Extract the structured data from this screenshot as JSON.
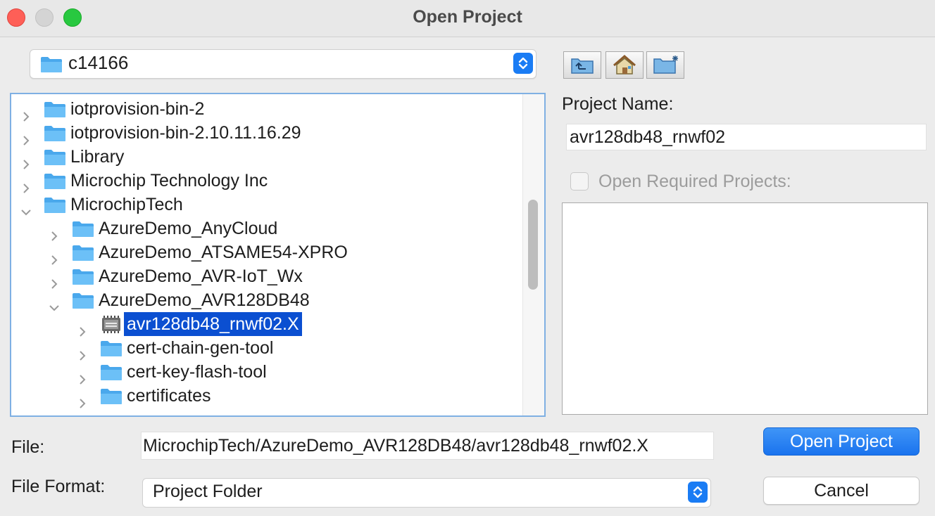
{
  "window": {
    "title": "Open Project"
  },
  "location": {
    "current_folder": "c14166"
  },
  "tree": {
    "items": [
      {
        "label": "iotprovision-bin-2",
        "level": 0,
        "expanded": false,
        "icon": "folder-icon",
        "selected": false
      },
      {
        "label": "iotprovision-bin-2.10.11.16.29",
        "level": 0,
        "expanded": false,
        "icon": "folder-icon",
        "selected": false
      },
      {
        "label": "Library",
        "level": 0,
        "expanded": false,
        "icon": "folder-icon",
        "selected": false
      },
      {
        "label": "Microchip Technology Inc",
        "level": 0,
        "expanded": false,
        "icon": "folder-icon",
        "selected": false
      },
      {
        "label": "MicrochipTech",
        "level": 0,
        "expanded": true,
        "icon": "folder-icon",
        "selected": false
      },
      {
        "label": "AzureDemo_AnyCloud",
        "level": 1,
        "expanded": false,
        "icon": "folder-icon",
        "selected": false
      },
      {
        "label": "AzureDemo_ATSAME54-XPRO",
        "level": 1,
        "expanded": false,
        "icon": "folder-icon",
        "selected": false
      },
      {
        "label": "AzureDemo_AVR-IoT_Wx",
        "level": 1,
        "expanded": false,
        "icon": "folder-icon",
        "selected": false
      },
      {
        "label": "AzureDemo_AVR128DB48",
        "level": 1,
        "expanded": true,
        "icon": "folder-icon",
        "selected": false
      },
      {
        "label": "avr128db48_rnwf02.X",
        "level": 2,
        "expanded": false,
        "icon": "chip-project-icon",
        "selected": true
      },
      {
        "label": "cert-chain-gen-tool",
        "level": 2,
        "expanded": false,
        "icon": "folder-icon",
        "selected": false
      },
      {
        "label": "cert-key-flash-tool",
        "level": 2,
        "expanded": false,
        "icon": "folder-icon",
        "selected": false
      },
      {
        "label": "certificates",
        "level": 2,
        "expanded": false,
        "icon": "folder-icon",
        "selected": false
      }
    ]
  },
  "toolbar": {
    "buttons": [
      {
        "name": "up-folder-button",
        "icon": "up-folder-icon"
      },
      {
        "name": "home-button",
        "icon": "home-icon"
      },
      {
        "name": "new-folder-button",
        "icon": "new-folder-icon"
      }
    ]
  },
  "project": {
    "name_label": "Project Name:",
    "name_value": "avr128db48_rnwf02",
    "open_required_label": "Open Required Projects:",
    "open_required_checked": false
  },
  "file": {
    "label": "File:",
    "value": "MicrochipTech/AzureDemo_AVR128DB48/avr128db48_rnwf02.X",
    "format_label": "File Format:",
    "format_value": "Project Folder"
  },
  "actions": {
    "open_label": "Open Project",
    "cancel_label": "Cancel"
  },
  "colors": {
    "accent": "#1a73ee",
    "folder": "#5ab4f0",
    "selection": "#0b4fd1",
    "close": "#fe5f57",
    "maximize": "#28c840"
  }
}
